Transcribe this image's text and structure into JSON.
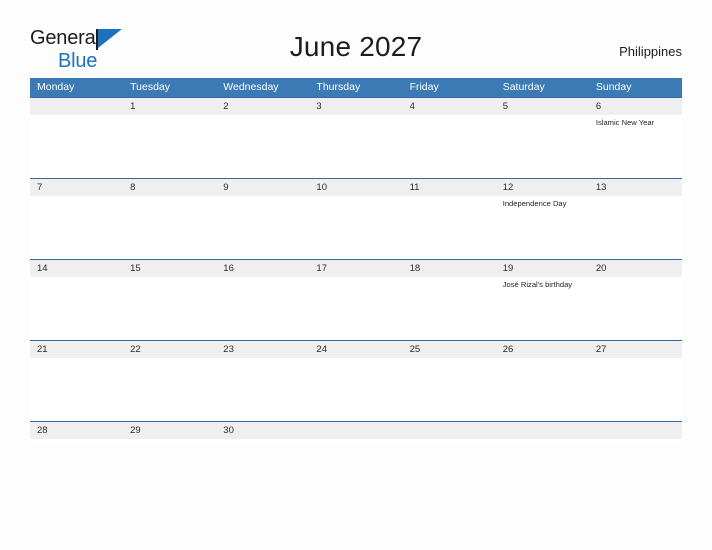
{
  "branding": {
    "logo_line1": "General",
    "logo_line2": "Blue",
    "logo_icon": "flag-triangle-icon",
    "color_primary": "#1e72bd",
    "color_text": "#1c1c1c"
  },
  "header": {
    "title": "June 2027",
    "country": "Philippines"
  },
  "calendar": {
    "header_background": "#3c7ab6",
    "row_separator_color": "#2f6ca5",
    "number_band_background": "#efefef",
    "weekday_headers": [
      "Monday",
      "Tuesday",
      "Wednesday",
      "Thursday",
      "Friday",
      "Saturday",
      "Sunday"
    ],
    "weeks": [
      [
        {
          "day": "",
          "event": ""
        },
        {
          "day": "1",
          "event": ""
        },
        {
          "day": "2",
          "event": ""
        },
        {
          "day": "3",
          "event": ""
        },
        {
          "day": "4",
          "event": ""
        },
        {
          "day": "5",
          "event": ""
        },
        {
          "day": "6",
          "event": "Islamic New Year"
        }
      ],
      [
        {
          "day": "7",
          "event": ""
        },
        {
          "day": "8",
          "event": ""
        },
        {
          "day": "9",
          "event": ""
        },
        {
          "day": "10",
          "event": ""
        },
        {
          "day": "11",
          "event": ""
        },
        {
          "day": "12",
          "event": "Independence Day"
        },
        {
          "day": "13",
          "event": ""
        }
      ],
      [
        {
          "day": "14",
          "event": ""
        },
        {
          "day": "15",
          "event": ""
        },
        {
          "day": "16",
          "event": ""
        },
        {
          "day": "17",
          "event": ""
        },
        {
          "day": "18",
          "event": ""
        },
        {
          "day": "19",
          "event": "José Rizal's birthday"
        },
        {
          "day": "20",
          "event": ""
        }
      ],
      [
        {
          "day": "21",
          "event": ""
        },
        {
          "day": "22",
          "event": ""
        },
        {
          "day": "23",
          "event": ""
        },
        {
          "day": "24",
          "event": ""
        },
        {
          "day": "25",
          "event": ""
        },
        {
          "day": "26",
          "event": ""
        },
        {
          "day": "27",
          "event": ""
        }
      ],
      [
        {
          "day": "28",
          "event": ""
        },
        {
          "day": "29",
          "event": ""
        },
        {
          "day": "30",
          "event": ""
        },
        {
          "day": "",
          "event": ""
        },
        {
          "day": "",
          "event": ""
        },
        {
          "day": "",
          "event": ""
        },
        {
          "day": "",
          "event": ""
        }
      ]
    ]
  }
}
